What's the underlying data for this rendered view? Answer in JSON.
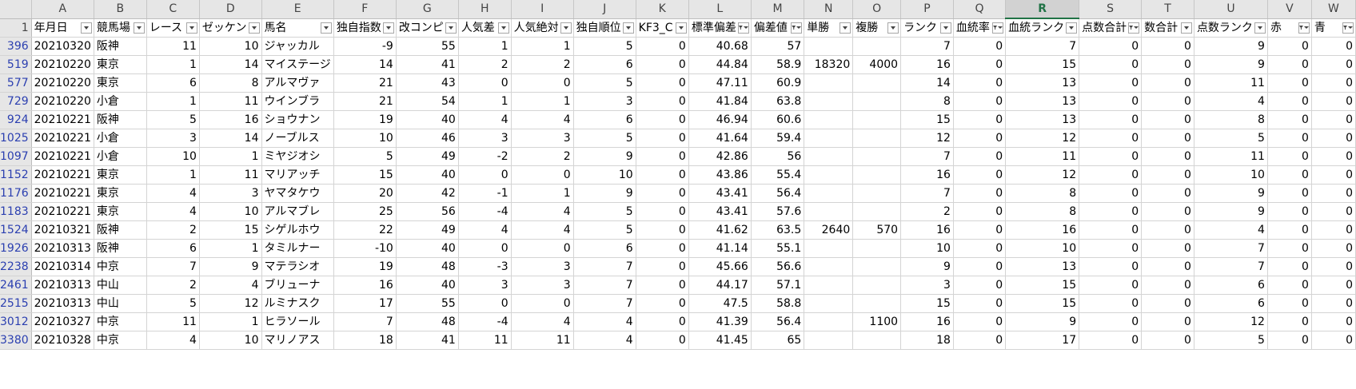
{
  "sheet": {
    "selected_column": "R",
    "corner": "",
    "columns": [
      "A",
      "B",
      "C",
      "D",
      "E",
      "F",
      "G",
      "H",
      "I",
      "J",
      "K",
      "L",
      "M",
      "N",
      "O",
      "P",
      "Q",
      "R",
      "S",
      "T",
      "U",
      "V",
      "W"
    ],
    "header_row_number": "1",
    "field_headers": [
      {
        "label": "年月日",
        "filter": "dropdown"
      },
      {
        "label": "競馬場",
        "filter": "dropdown"
      },
      {
        "label": "レース",
        "filter": "dropdown"
      },
      {
        "label": "ゼッケン",
        "filter": "dropdown"
      },
      {
        "label": "馬名",
        "filter": "dropdown"
      },
      {
        "label": "独自指数",
        "filter": "dropdown"
      },
      {
        "label": "改コンピ",
        "filter": "dropdown"
      },
      {
        "label": "人気差",
        "filter": "dropdown"
      },
      {
        "label": "人気絶対",
        "filter": "dropdown"
      },
      {
        "label": "独自順位",
        "filter": "dropdown"
      },
      {
        "label": "KF3_C",
        "filter": "dropdown"
      },
      {
        "label": "標準偏差",
        "filter": "filtered"
      },
      {
        "label": "偏差値",
        "filter": "filtered"
      },
      {
        "label": "単勝",
        "filter": "dropdown"
      },
      {
        "label": "複勝",
        "filter": "dropdown"
      },
      {
        "label": "ランク",
        "filter": "dropdown"
      },
      {
        "label": "血統率",
        "filter": "filtered"
      },
      {
        "label": "血統ランク",
        "filter": "dropdown"
      },
      {
        "label": "点数合計",
        "filter": "filtered"
      },
      {
        "label": "数合計",
        "filter": "dropdown"
      },
      {
        "label": "点数ランク",
        "filter": "dropdown"
      },
      {
        "label": "赤",
        "filter": "filtered"
      },
      {
        "label": "青",
        "filter": "filtered"
      }
    ],
    "rows": [
      {
        "num": "396",
        "cells": [
          "20210320",
          "阪神",
          "11",
          "10",
          "ジャッカル",
          "-9",
          "55",
          "1",
          "1",
          "5",
          "0",
          "40.68",
          "57",
          "",
          "",
          "7",
          "0",
          "7",
          "0",
          "0",
          "9",
          "0",
          "0"
        ]
      },
      {
        "num": "519",
        "cells": [
          "20210220",
          "東京",
          "1",
          "14",
          "マイステージ",
          "14",
          "41",
          "2",
          "2",
          "6",
          "0",
          "44.84",
          "58.9",
          "18320",
          "4000",
          "16",
          "0",
          "15",
          "0",
          "0",
          "9",
          "0",
          "0"
        ]
      },
      {
        "num": "577",
        "cells": [
          "20210220",
          "東京",
          "6",
          "8",
          "アルマヴァ",
          "21",
          "43",
          "0",
          "0",
          "5",
          "0",
          "47.11",
          "60.9",
          "",
          "",
          "14",
          "0",
          "13",
          "0",
          "0",
          "11",
          "0",
          "0"
        ]
      },
      {
        "num": "729",
        "cells": [
          "20210220",
          "小倉",
          "1",
          "11",
          "ウインブラ",
          "21",
          "54",
          "1",
          "1",
          "3",
          "0",
          "41.84",
          "63.8",
          "",
          "",
          "8",
          "0",
          "13",
          "0",
          "0",
          "4",
          "0",
          "0"
        ]
      },
      {
        "num": "924",
        "cells": [
          "20210221",
          "阪神",
          "5",
          "16",
          "ショウナン",
          "19",
          "40",
          "4",
          "4",
          "6",
          "0",
          "46.94",
          "60.6",
          "",
          "",
          "15",
          "0",
          "13",
          "0",
          "0",
          "8",
          "0",
          "0"
        ]
      },
      {
        "num": "1025",
        "cells": [
          "20210221",
          "小倉",
          "3",
          "14",
          "ノーブルス",
          "10",
          "46",
          "3",
          "3",
          "5",
          "0",
          "41.64",
          "59.4",
          "",
          "",
          "12",
          "0",
          "12",
          "0",
          "0",
          "5",
          "0",
          "0"
        ]
      },
      {
        "num": "1097",
        "cells": [
          "20210221",
          "小倉",
          "10",
          "1",
          "ミヤジオシ",
          "5",
          "49",
          "-2",
          "2",
          "9",
          "0",
          "42.86",
          "56",
          "",
          "",
          "7",
          "0",
          "11",
          "0",
          "0",
          "11",
          "0",
          "0"
        ]
      },
      {
        "num": "1152",
        "cells": [
          "20210221",
          "東京",
          "1",
          "11",
          "マリアッチ",
          "15",
          "40",
          "0",
          "0",
          "10",
          "0",
          "43.86",
          "55.4",
          "",
          "",
          "16",
          "0",
          "12",
          "0",
          "0",
          "10",
          "0",
          "0"
        ]
      },
      {
        "num": "1176",
        "cells": [
          "20210221",
          "東京",
          "4",
          "3",
          "ヤマタケウ",
          "20",
          "42",
          "-1",
          "1",
          "9",
          "0",
          "43.41",
          "56.4",
          "",
          "",
          "7",
          "0",
          "8",
          "0",
          "0",
          "9",
          "0",
          "0"
        ]
      },
      {
        "num": "1183",
        "cells": [
          "20210221",
          "東京",
          "4",
          "10",
          "アルマブレ",
          "25",
          "56",
          "-4",
          "4",
          "5",
          "0",
          "43.41",
          "57.6",
          "",
          "",
          "2",
          "0",
          "8",
          "0",
          "0",
          "9",
          "0",
          "0"
        ]
      },
      {
        "num": "1524",
        "cells": [
          "20210321",
          "阪神",
          "2",
          "15",
          "シゲルホウ",
          "22",
          "49",
          "4",
          "4",
          "5",
          "0",
          "41.62",
          "63.5",
          "2640",
          "570",
          "16",
          "0",
          "16",
          "0",
          "0",
          "4",
          "0",
          "0"
        ]
      },
      {
        "num": "1926",
        "cells": [
          "20210313",
          "阪神",
          "6",
          "1",
          "タミルナー",
          "-10",
          "40",
          "0",
          "0",
          "6",
          "0",
          "41.14",
          "55.1",
          "",
          "",
          "10",
          "0",
          "10",
          "0",
          "0",
          "7",
          "0",
          "0"
        ]
      },
      {
        "num": "2238",
        "cells": [
          "20210314",
          "中京",
          "7",
          "9",
          "マテラシオ",
          "19",
          "48",
          "-3",
          "3",
          "7",
          "0",
          "45.66",
          "56.6",
          "",
          "",
          "9",
          "0",
          "13",
          "0",
          "0",
          "7",
          "0",
          "0"
        ]
      },
      {
        "num": "2461",
        "cells": [
          "20210313",
          "中山",
          "2",
          "4",
          "ブリューナ",
          "16",
          "40",
          "3",
          "3",
          "7",
          "0",
          "44.17",
          "57.1",
          "",
          "",
          "3",
          "0",
          "15",
          "0",
          "0",
          "6",
          "0",
          "0"
        ]
      },
      {
        "num": "2515",
        "cells": [
          "20210313",
          "中山",
          "5",
          "12",
          "ルミナスク",
          "17",
          "55",
          "0",
          "0",
          "7",
          "0",
          "47.5",
          "58.8",
          "",
          "",
          "15",
          "0",
          "15",
          "0",
          "0",
          "6",
          "0",
          "0"
        ]
      },
      {
        "num": "3012",
        "cells": [
          "20210327",
          "中京",
          "11",
          "1",
          "ヒラソール",
          "7",
          "48",
          "-4",
          "4",
          "4",
          "0",
          "41.39",
          "56.4",
          "",
          "1100",
          "16",
          "0",
          "9",
          "0",
          "0",
          "12",
          "0",
          "0"
        ]
      },
      {
        "num": "3380",
        "cells": [
          "20210328",
          "中京",
          "4",
          "10",
          "マリノアス",
          "18",
          "41",
          "11",
          "11",
          "4",
          "0",
          "41.45",
          "65",
          "",
          "",
          "18",
          "0",
          "17",
          "0",
          "0",
          "5",
          "0",
          "0"
        ]
      }
    ]
  }
}
